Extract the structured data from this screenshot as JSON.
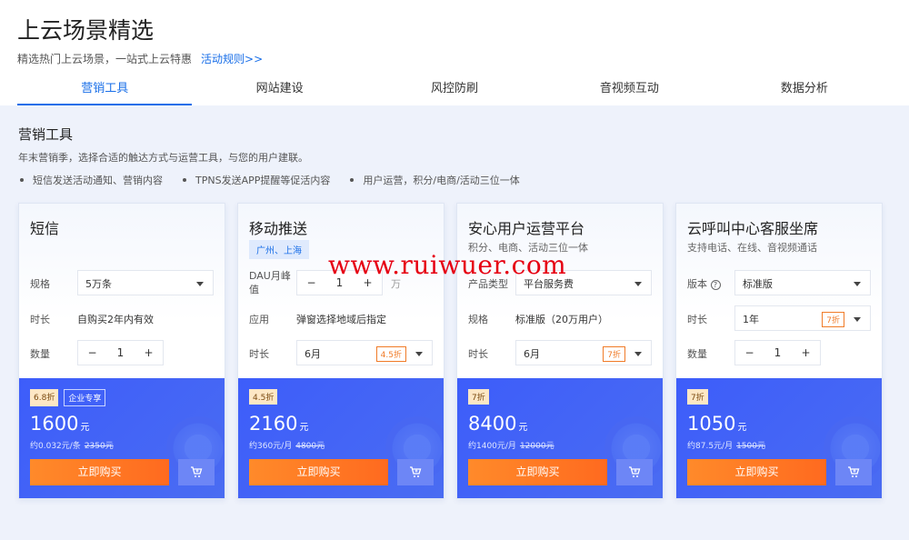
{
  "header": {
    "title": "上云场景精选",
    "subtitle": "精选热门上云场景，一站式上云特惠",
    "rules_link": "活动规则>>"
  },
  "tabs": [
    {
      "label": "营销工具",
      "active": true
    },
    {
      "label": "网站建设"
    },
    {
      "label": "风控防刷"
    },
    {
      "label": "音视频互动"
    },
    {
      "label": "数据分析"
    }
  ],
  "section": {
    "title": "营销工具",
    "desc": "年末营销季，选择合适的触达方式与运营工具，与您的用户建联。",
    "bullets": [
      "短信发送活动通知、营销内容",
      "TPNS发送APP提醒等促活内容",
      "用户运营，积分/电商/活动三位一体"
    ]
  },
  "cards": [
    {
      "title": "短信",
      "spec_label": "规格",
      "spec_value": "5万条",
      "duration_label": "时长",
      "duration_value": "自购买2年内有效",
      "qty_label": "数量",
      "qty_minus": "−",
      "qty_value": "1",
      "qty_plus": "+",
      "discount": "6.8折",
      "tag": "企业专享",
      "price": "1600",
      "currency": "元",
      "unit_price": "约0.032元/条",
      "orig_price": "2350元",
      "buy": "立即购买"
    },
    {
      "title": "移动推送",
      "city": "广州、上海",
      "dau_label": "DAU月峰值",
      "dau_minus": "−",
      "dau_value": "1",
      "dau_plus": "+",
      "dau_unit": "万",
      "app_label": "应用",
      "app_value": "弹窗选择地域后指定",
      "duration_label": "时长",
      "duration_value": "6月",
      "duration_disc": "4.5折",
      "discount": "4.5折",
      "price": "2160",
      "currency": "元",
      "unit_price": "约360元/月",
      "orig_price": "4800元",
      "buy": "立即购买"
    },
    {
      "title": "安心用户运营平台",
      "subtitle": "积分、电商、活动三位一体",
      "type_label": "产品类型",
      "type_value": "平台服务费",
      "spec_label": "规格",
      "spec_value": "标准版（20万用户）",
      "duration_label": "时长",
      "duration_value": "6月",
      "duration_disc": "7折",
      "discount": "7折",
      "price": "8400",
      "currency": "元",
      "unit_price": "约1400元/月",
      "orig_price": "12000元",
      "buy": "立即购买"
    },
    {
      "title": "云呼叫中心客服坐席",
      "subtitle": "支持电话、在线、音视频通话",
      "version_label": "版本",
      "version_value": "标准版",
      "duration_label": "时长",
      "duration_value": "1年",
      "duration_disc": "7折",
      "qty_label": "数量",
      "qty_minus": "−",
      "qty_value": "1",
      "qty_plus": "+",
      "discount": "7折",
      "price": "1050",
      "currency": "元",
      "unit_price": "约87.5元/月",
      "orig_price": "1500元",
      "buy": "立即购买"
    }
  ],
  "watermark": "www.ruiwuer.com",
  "colors": {
    "accent": "#1a6fe8",
    "buy": "#ff7a26",
    "panel": "#3d5dfa"
  }
}
